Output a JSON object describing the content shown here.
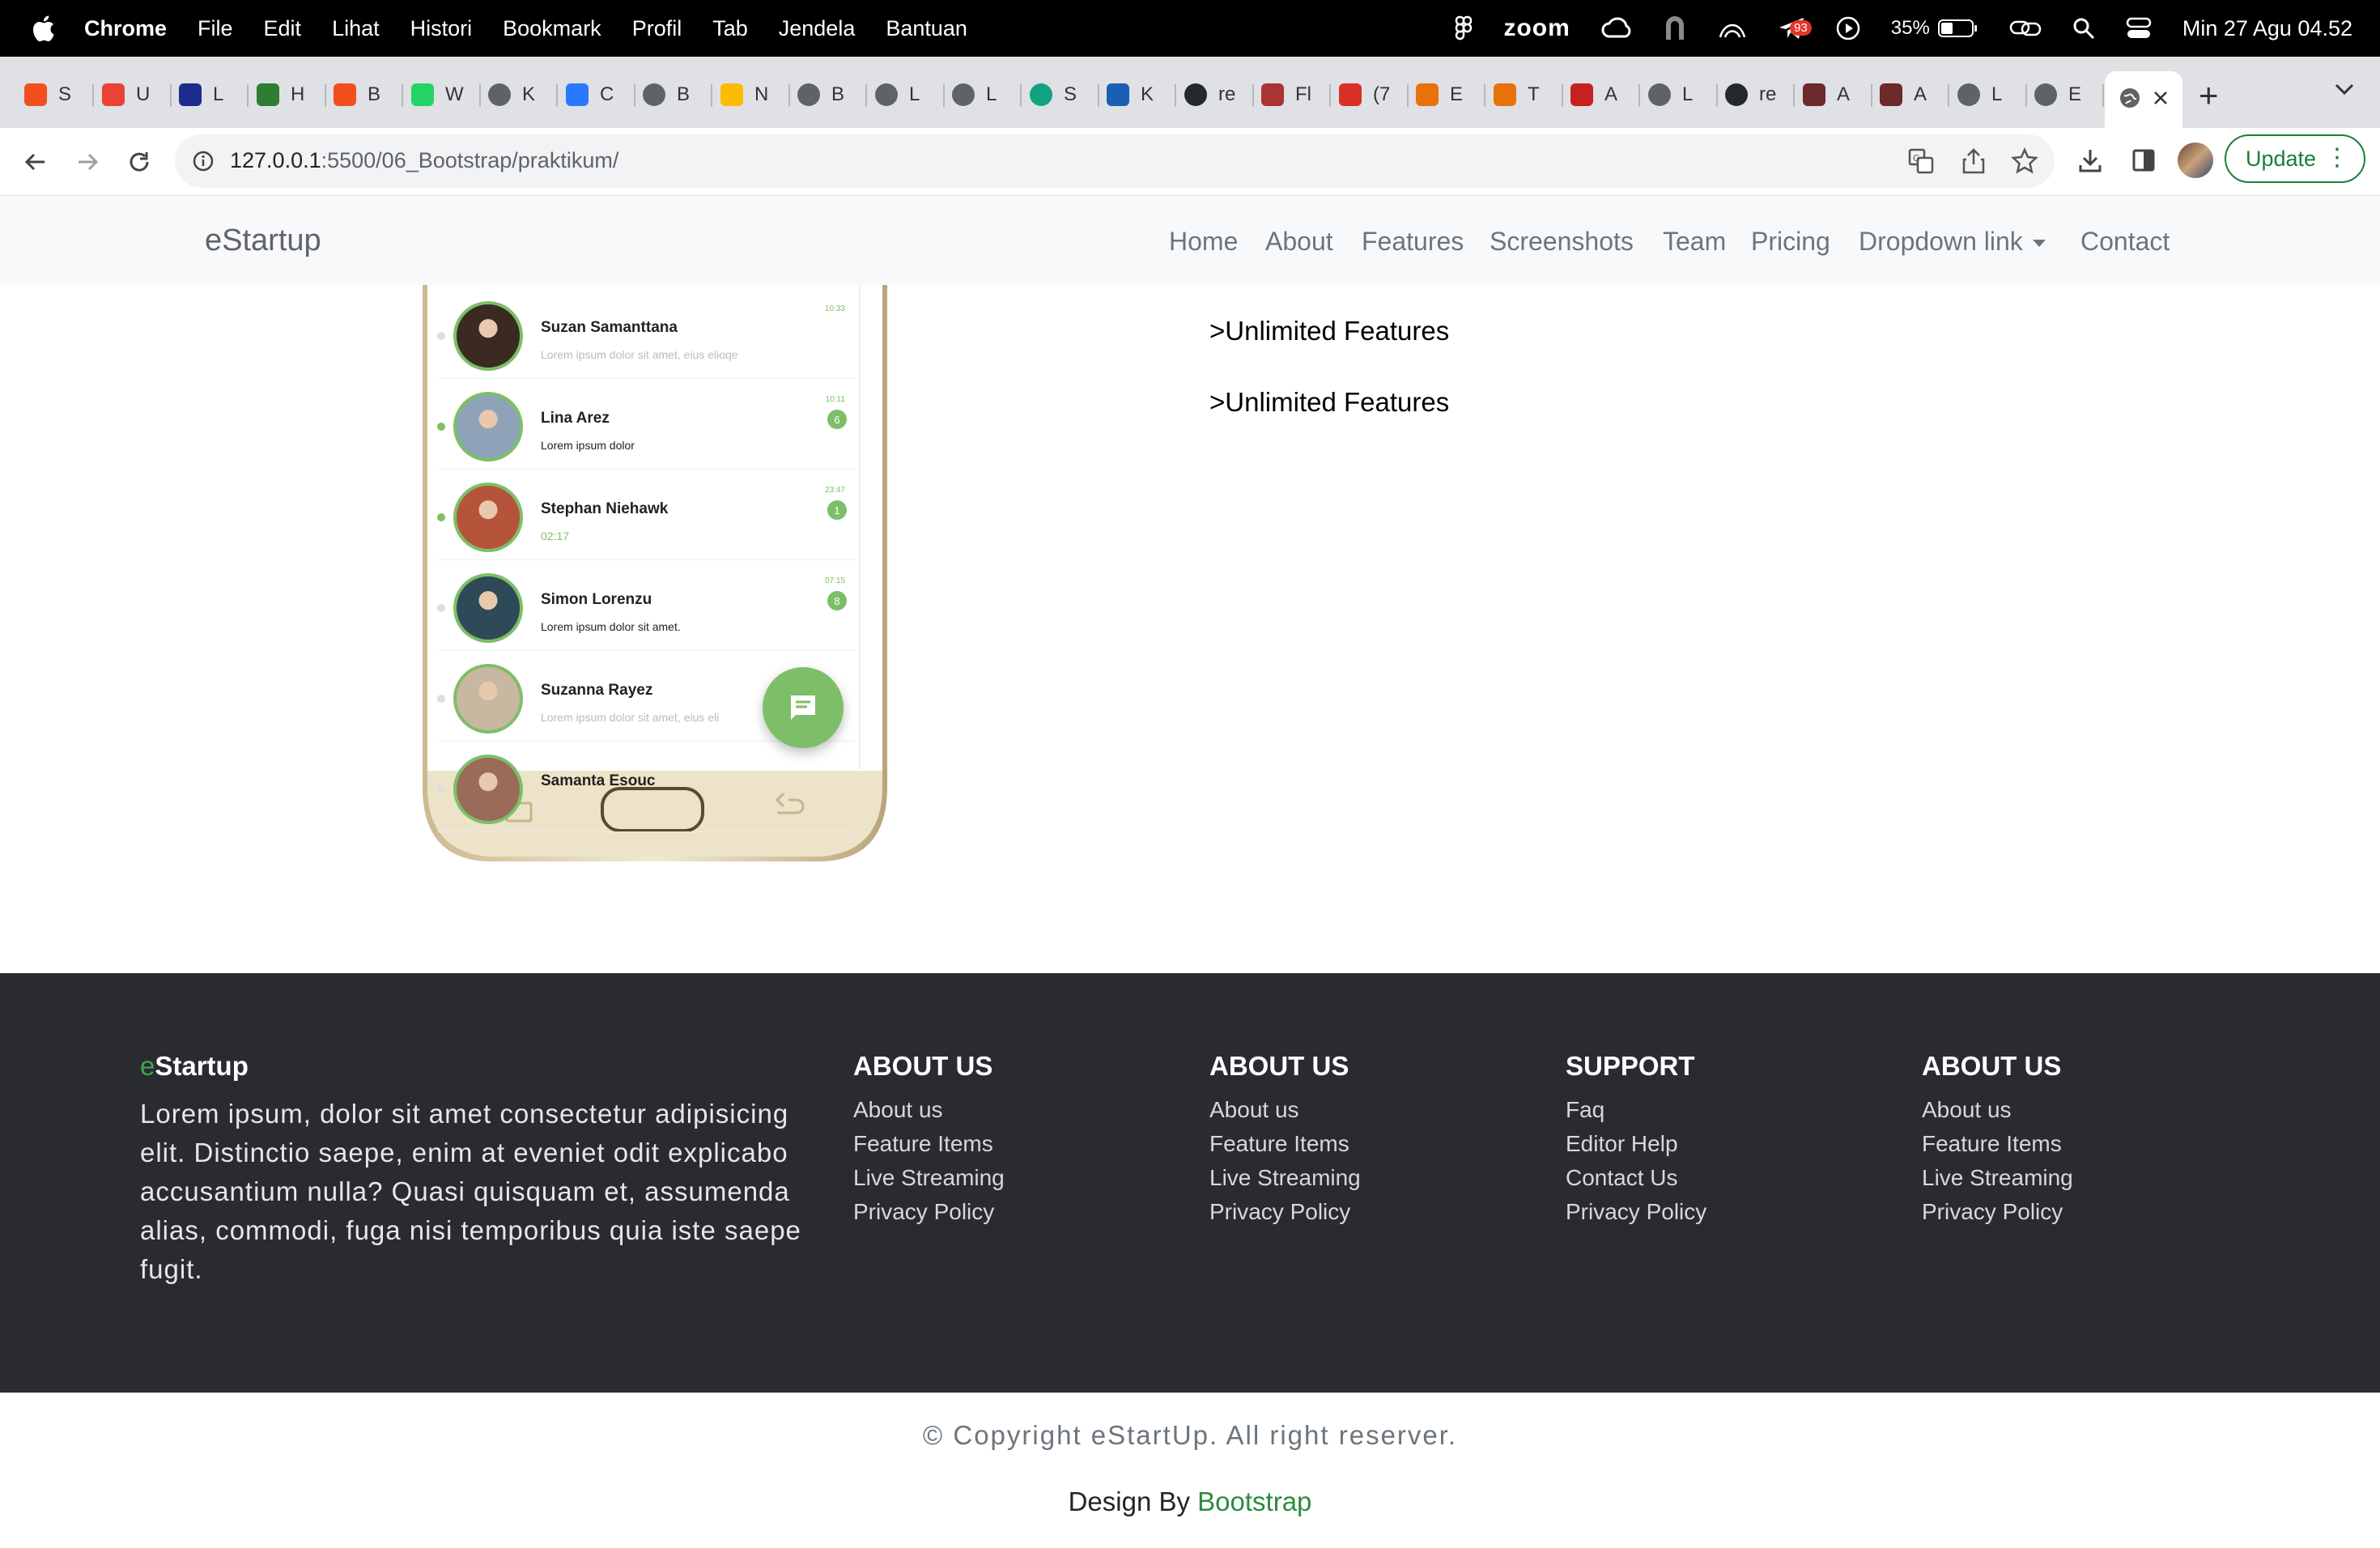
{
  "menubar": {
    "app_name": "Chrome",
    "items": [
      "File",
      "Edit",
      "Lihat",
      "Histori",
      "Bookmark",
      "Profil",
      "Tab",
      "Jendela",
      "Bantuan"
    ],
    "zoom_label": "zoom",
    "notif_count": "93",
    "battery": "35%",
    "datetime": "Min 27 Agu  04.52"
  },
  "tabs": [
    {
      "letter": "S",
      "color": "#f24e1e",
      "icon": "figma-icon"
    },
    {
      "letter": "U",
      "color": "#ea4335",
      "icon": "gmail-icon"
    },
    {
      "letter": "L",
      "color": "#1a2b8c",
      "icon": "onet-icon"
    },
    {
      "letter": "H",
      "color": "#2e7d32",
      "icon": "w3-icon"
    },
    {
      "letter": "B",
      "color": "#f24e1e",
      "icon": "figma-icon"
    },
    {
      "letter": "W",
      "color": "#25d366",
      "icon": "whatsapp-icon"
    },
    {
      "letter": "K",
      "color": "#5f6368",
      "icon": "globe-icon"
    },
    {
      "letter": "C",
      "color": "#2979ff",
      "icon": "canva-icon"
    },
    {
      "letter": "B",
      "color": "#5f6368",
      "icon": "globe-icon"
    },
    {
      "letter": "N",
      "color": "#fbbc04",
      "icon": "drive-icon"
    },
    {
      "letter": "B",
      "color": "#5f6368",
      "icon": "globe-icon"
    },
    {
      "letter": "L",
      "color": "#5f6368",
      "icon": "globe-icon"
    },
    {
      "letter": "L",
      "color": "#5f6368",
      "icon": "globe-icon"
    },
    {
      "letter": "S",
      "color": "#10a37f",
      "icon": "chatgpt-icon"
    },
    {
      "letter": "K",
      "color": "#1a5fb4",
      "icon": "site-icon"
    },
    {
      "letter": "re",
      "color": "#24292f",
      "icon": "github-icon"
    },
    {
      "letter": "Fl",
      "color": "#a33",
      "icon": "site-icon"
    },
    {
      "letter": "(7",
      "color": "#d93025",
      "icon": "badge-778-icon"
    },
    {
      "letter": "E",
      "color": "#e8710a",
      "icon": "site-icon"
    },
    {
      "letter": "T",
      "color": "#e8710a",
      "icon": "site-icon"
    },
    {
      "letter": "A",
      "color": "#c5221f",
      "icon": "acrobat-icon"
    },
    {
      "letter": "L",
      "color": "#5f6368",
      "icon": "globe-icon"
    },
    {
      "letter": "re",
      "color": "#24292f",
      "icon": "github-icon"
    },
    {
      "letter": "A",
      "color": "#6d2a2a",
      "icon": "site-icon"
    },
    {
      "letter": "A",
      "color": "#6d2a2a",
      "icon": "site-icon"
    },
    {
      "letter": "L",
      "color": "#5f6368",
      "icon": "globe-icon"
    },
    {
      "letter": "E",
      "color": "#5f6368",
      "icon": "globe-icon"
    }
  ],
  "address": {
    "host": "127.0.0.1",
    "path": ":5500/06_Bootstrap/praktikum/"
  },
  "update_label": "Update",
  "navbar": {
    "brand": "eStartup",
    "links": [
      "Home",
      "About",
      "Features",
      "Screenshots",
      "Team",
      "Pricing",
      "Dropdown link",
      "Contact"
    ]
  },
  "features": [
    ">Unlimited Features",
    ">Unlimited Features"
  ],
  "phone": {
    "contacts": [
      {
        "name": "Suzan Samanttana",
        "msg": "Lorem ipsum dolor sit amet, eius elioqe",
        "time": "10:33",
        "count": ""
      },
      {
        "name": "Lina Arez",
        "msg": "Lorem ipsum dolor",
        "time": "10:11",
        "count": "6"
      },
      {
        "name": "Stephan Niehawk",
        "msg": "02:17",
        "time": "23:47",
        "count": "1"
      },
      {
        "name": "Simon Lorenzu",
        "msg": "Lorem ipsum dolor sit amet.",
        "time": "07:15",
        "count": "8"
      },
      {
        "name": "Suzanna Rayez",
        "msg": "Lorem ipsum dolor sit amet, eius eli",
        "time": "",
        "count": ""
      },
      {
        "name": "Samanta Esouc",
        "msg": "",
        "time": "",
        "count": ""
      }
    ]
  },
  "footer": {
    "brand_e": "e",
    "brand_rest": "Startup",
    "description": "Lorem ipsum, dolor sit amet consectetur adipisicing elit. Distinctio saepe, enim at eveniet odit explicabo accusantium nulla? Quasi quisquam et, assumenda alias, commodi, fuga nisi temporibus quia iste saepe fugit.",
    "columns": [
      {
        "heading": "ABOUT US",
        "links": [
          "About us",
          "Feature Items",
          "Live Streaming",
          "Privacy Policy"
        ]
      },
      {
        "heading": "ABOUT US",
        "links": [
          "About us",
          "Feature Items",
          "Live Streaming",
          "Privacy Policy"
        ]
      },
      {
        "heading": "SUPPORT",
        "links": [
          "Faq",
          "Editor Help",
          "Contact Us",
          "Privacy Policy"
        ]
      },
      {
        "heading": "ABOUT US",
        "links": [
          "About us",
          "Feature Items",
          "Live Streaming",
          "Privacy Policy"
        ]
      }
    ]
  },
  "copyright": "© Copyright eStartUp. All right reserver.",
  "design_by": "Design By ",
  "design_by_link": "Bootstrap",
  "colors": {
    "accent": "#2d8a3e",
    "footer_bg": "#2a2b30",
    "navbar_bg": "#f8f9fa"
  }
}
